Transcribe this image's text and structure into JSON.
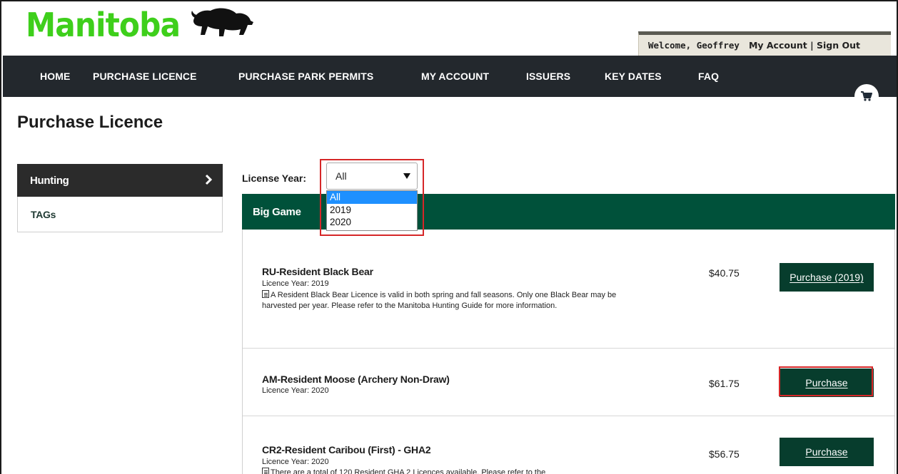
{
  "brand": {
    "logo_text": "Manitoba"
  },
  "account": {
    "welcome": "Welcome, Geoffrey",
    "links": "My Account | Sign Out"
  },
  "nav": {
    "items": [
      {
        "label": "HOME"
      },
      {
        "label": "PURCHASE LICENCE"
      },
      {
        "label": "PURCHASE PARK PERMITS"
      },
      {
        "label": "MY ACCOUNT"
      },
      {
        "label": "ISSUERS"
      },
      {
        "label": "KEY DATES"
      },
      {
        "label": "FAQ"
      }
    ],
    "cart_icon": "cart-icon"
  },
  "page": {
    "title": "Purchase Licence"
  },
  "sidebar": {
    "items": [
      {
        "label": "Hunting",
        "active": true
      },
      {
        "label": "TAGs",
        "active": false
      }
    ]
  },
  "filter": {
    "label": "License Year:",
    "selected": "All",
    "options": [
      "All",
      "2019",
      "2020"
    ]
  },
  "section": {
    "title": "Big Game"
  },
  "licences": [
    {
      "title": "RU-Resident Black Bear",
      "year": "Licence Year: 2019",
      "description": "A Resident Black Bear Licence is valid in both spring and fall seasons. Only one Black Bear may be harvested per year. Please refer to the Manitoba Hunting Guide for more information.",
      "price": "$40.75",
      "button": "Purchase (2019)"
    },
    {
      "title": "AM-Resident Moose (Archery Non-Draw)",
      "year": "Licence Year: 2020",
      "description": "",
      "price": "$61.75",
      "button": "Purchase"
    },
    {
      "title": "CR2-Resident Caribou (First) - GHA2",
      "year": "Licence Year: 2020",
      "description": "There are a total of 120 Resident GHA 2 Licences available. Please refer to the",
      "price": "$56.75",
      "button": "Purchase"
    }
  ],
  "colors": {
    "brand_green": "#3ecf1b",
    "nav_bg": "#23282d",
    "section_green": "#00513a",
    "button_green": "#073d2d",
    "highlight_red": "#d62728"
  }
}
